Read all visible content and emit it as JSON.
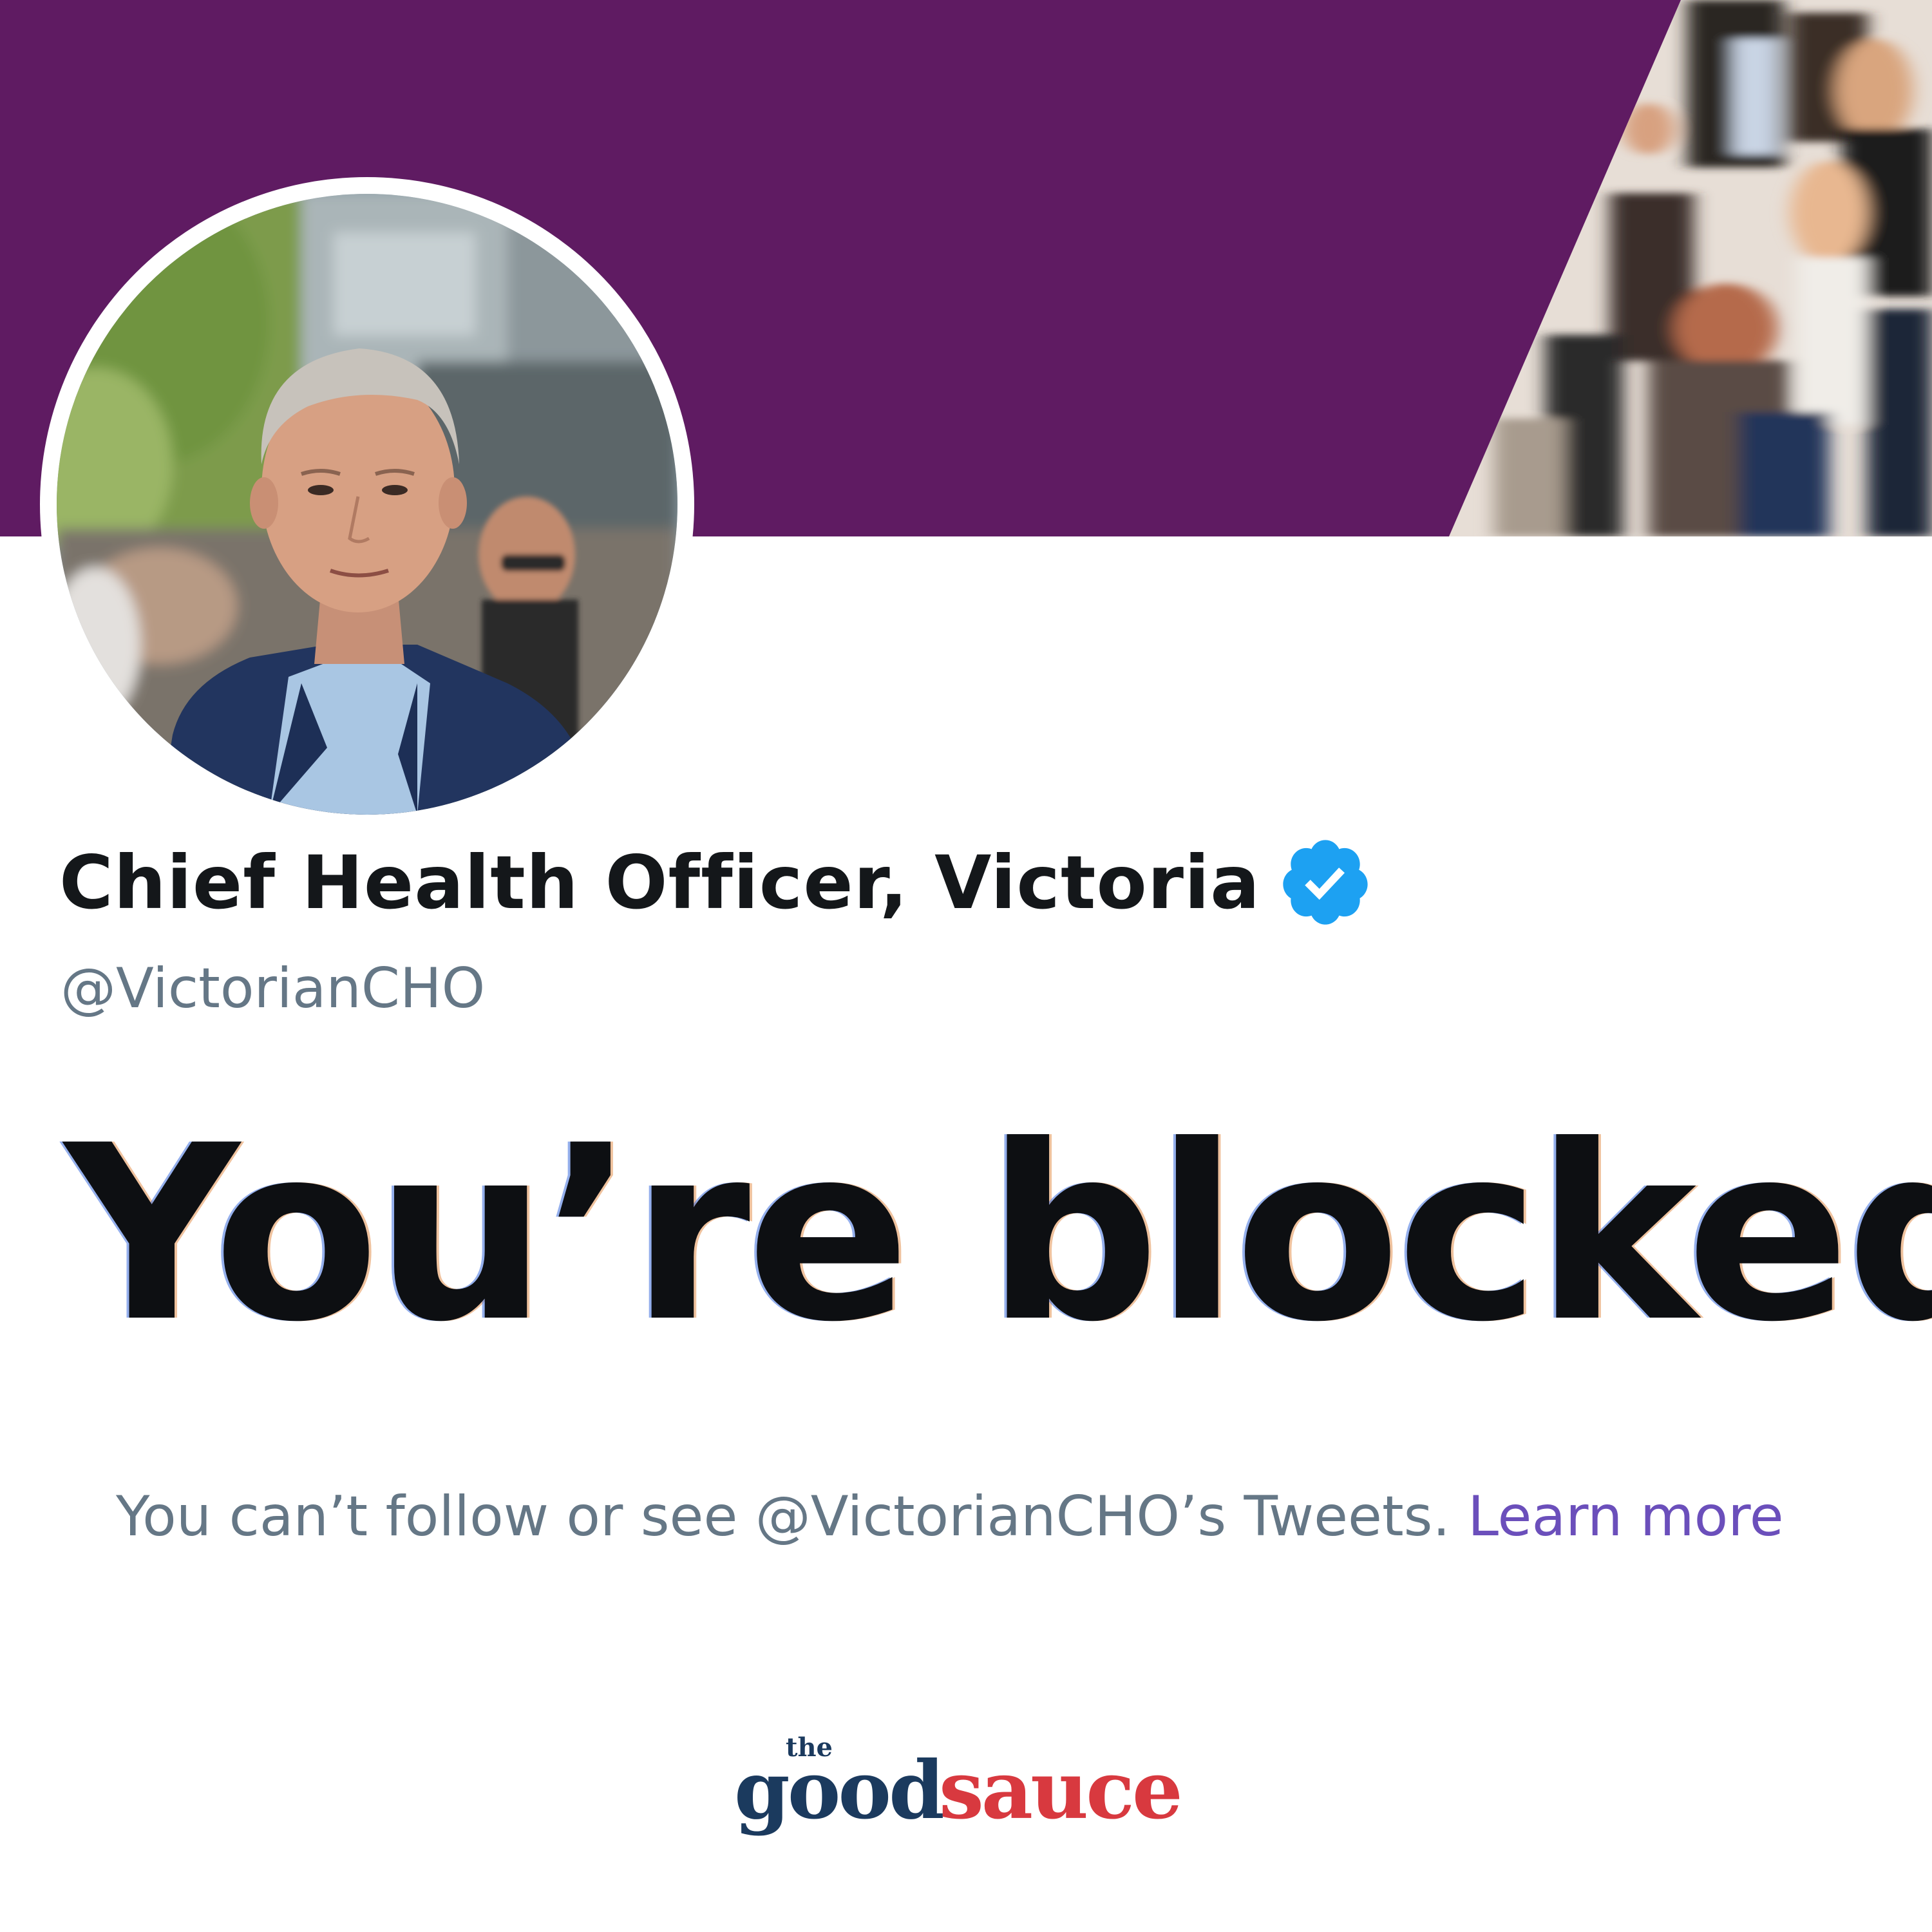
{
  "profile": {
    "display_name": "Chief Health Officer, Victoria",
    "handle": "@VictorianCHO",
    "verified": true,
    "verified_icon": "verified-badge-icon"
  },
  "blocked": {
    "heading": "You’re blocked",
    "message": "You can’t follow or see @VictorianCHO’s Tweets.",
    "learn_more": "Learn more"
  },
  "logo": {
    "the": "the",
    "good": "good",
    "sauce": "sauce"
  },
  "colors": {
    "banner": "#5f1b62",
    "name": "#14171a",
    "handle": "#657786",
    "link": "#6b4fbb",
    "verified": "#1da1f2",
    "logo_good": "#1b3a5e",
    "logo_sauce": "#d8393f"
  }
}
